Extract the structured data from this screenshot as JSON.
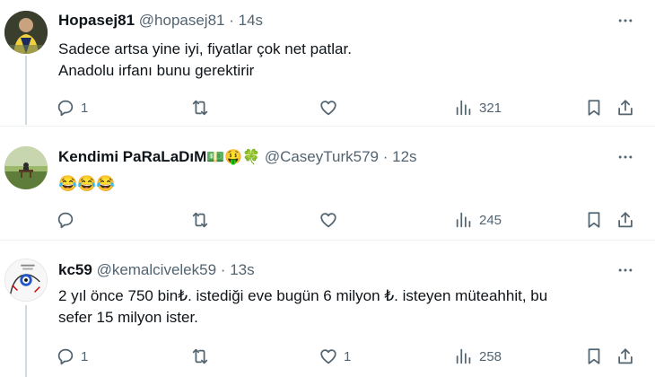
{
  "tweets": [
    {
      "name": "Hopasej81",
      "name_emoji": "",
      "handle": "@hopasej81",
      "separator": "·",
      "time": "14s",
      "lines": [
        "Sadece artsa yine iyi, fiyatlar çok net patlar.",
        "Anadolu irfanı bunu gerektirir"
      ],
      "counts": {
        "reply": "1",
        "retweet": "",
        "like": "",
        "views": "321"
      }
    },
    {
      "name": "Kendimi PaRaLaDıM",
      "name_emoji": "💵🤑🍀",
      "handle": "@CaseyTurk579",
      "separator": "·",
      "time": "12s",
      "lines": [
        "😂😂😂"
      ],
      "counts": {
        "reply": "",
        "retweet": "",
        "like": "",
        "views": "245"
      }
    },
    {
      "name": "kc59",
      "name_emoji": "",
      "handle": "@kemalcivelek59",
      "separator": "·",
      "time": "13s",
      "lines": [
        "2 yıl önce 750 bin₺. istediği eve bugün 6 milyon ₺. isteyen müteahhit, bu",
        "sefer 15 milyon ister."
      ],
      "counts": {
        "reply": "1",
        "retweet": "",
        "like": "1",
        "views": "258"
      }
    }
  ],
  "icons": {
    "reply": "reply-icon",
    "retweet": "retweet-icon",
    "like": "heart-icon",
    "views": "views-icon",
    "bookmark": "bookmark-icon",
    "share": "share-icon",
    "more": "more-icon"
  },
  "colors": {
    "text": "#0f1419",
    "secondary": "#536471",
    "divider": "#eff3f4",
    "thread_line": "#cfd9de"
  }
}
